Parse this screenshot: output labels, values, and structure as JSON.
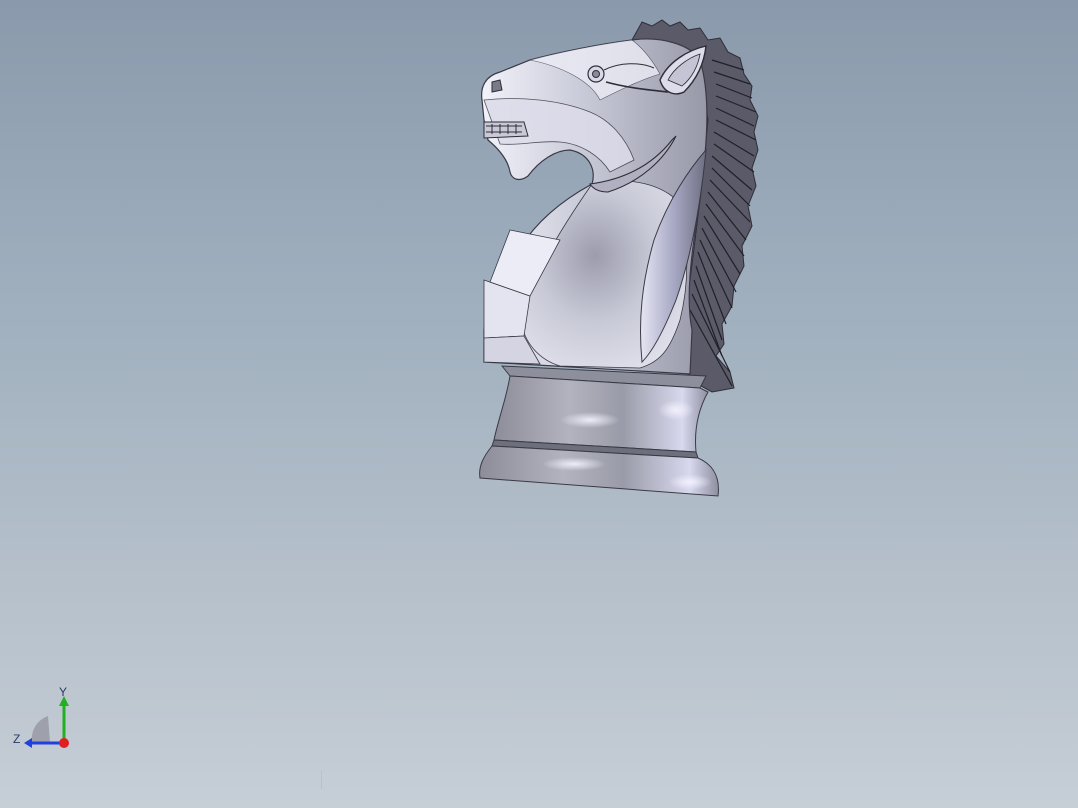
{
  "viewport": {
    "background_top": "#8a9aac",
    "background_bottom": "#c6ced6"
  },
  "model": {
    "part": "chess-knight",
    "colors": {
      "face_light": "#e8e8f2",
      "face_mid": "#b9bac8",
      "face_dark": "#7c7d8c",
      "base": "#a9aab6",
      "edge": "#3a3a46"
    }
  },
  "triad": {
    "x_axis_color": "#e02020",
    "y_axis_color": "#20b020",
    "z_axis_color": "#2040e0",
    "y_label": "Y",
    "z_label": "Z"
  }
}
